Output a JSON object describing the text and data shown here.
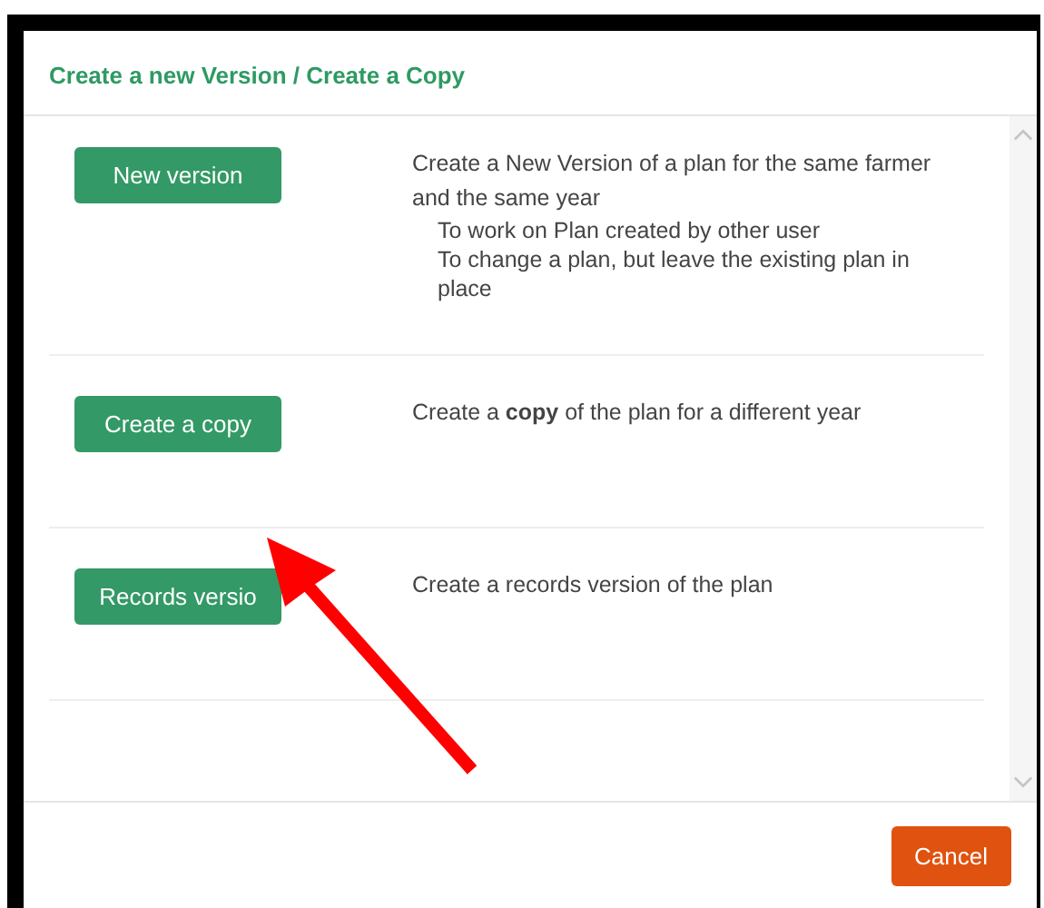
{
  "dialog": {
    "title": "Create a new Version / Create a Copy"
  },
  "options": [
    {
      "button": "New version",
      "description": "Create a New Version of a plan for the same farmer and the same year",
      "notes": [
        "To work on Plan created by other user",
        "To change a plan, but leave the existing plan in place"
      ]
    },
    {
      "button": "Create a copy",
      "description": "Create a **copy** of the plan for a different year"
    },
    {
      "button": "Records versio",
      "description": "Create a records version of the plan"
    }
  ],
  "footer": {
    "cancel": "Cancel"
  }
}
